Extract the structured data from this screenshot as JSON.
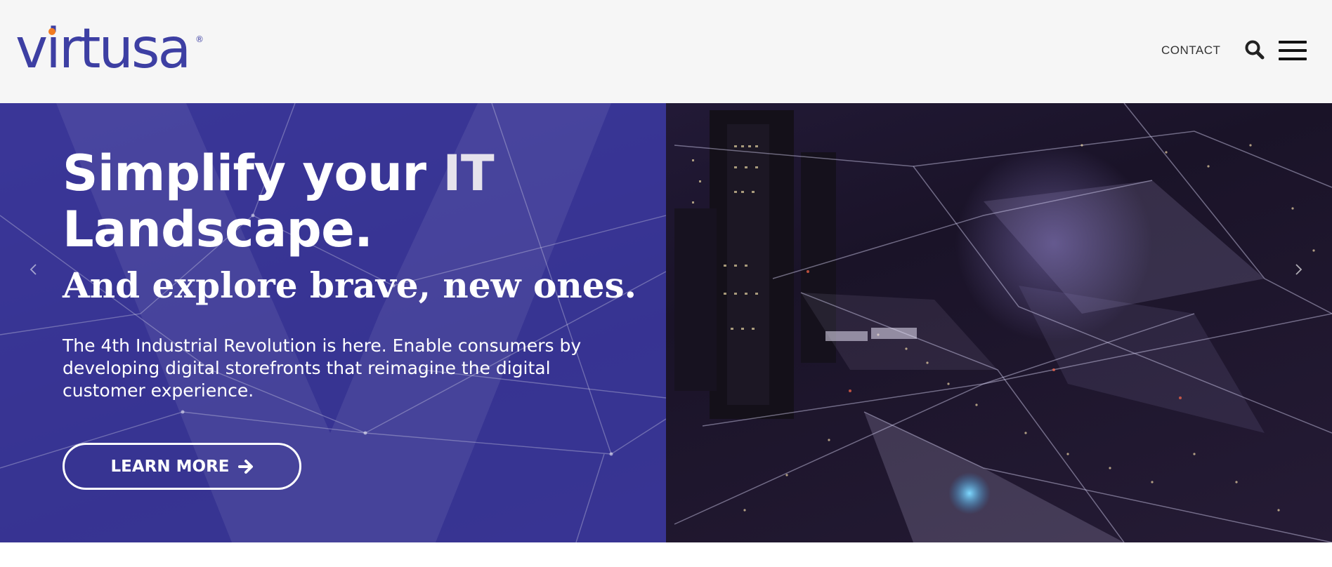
{
  "header": {
    "logo_text": "virtusa",
    "logo_registered": "®",
    "nav_contact": "CONTACT",
    "search_icon": "search-icon",
    "menu_icon": "hamburger-menu-icon"
  },
  "hero": {
    "headline_part1": "Simplify your ",
    "headline_part2": "IT",
    "headline_line2": "Landscape.",
    "subheadline": "And explore brave, new ones.",
    "body": "The 4th Industrial Revolution is here. Enable consumers by developing digital storefronts that reimagine the digital customer experience.",
    "cta_label": "LEARN MORE",
    "cta_icon": "arrow-right-icon",
    "prev_icon": "chevron-left-icon",
    "next_icon": "chevron-right-icon"
  },
  "colors": {
    "brand": "#3d3fa3",
    "accent_dot": "#f27c22",
    "header_bg": "#f6f6f6",
    "hero_overlay": "#3e3cac",
    "text_light": "#ffffff"
  }
}
